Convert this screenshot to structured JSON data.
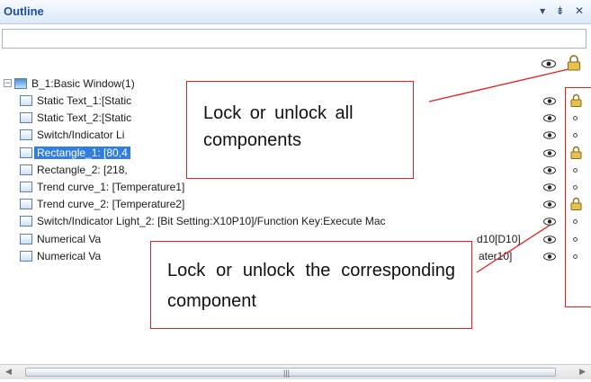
{
  "panel": {
    "title": "Outline",
    "controls": [
      "▾",
      "⇟",
      "✕"
    ],
    "search_value": ""
  },
  "tree": {
    "root_label": "B_1:Basic Window(1)",
    "items": [
      {
        "label": "Static Text_1:[Static",
        "icon": "static-text-icon",
        "state": "lock"
      },
      {
        "label": "Static Text_2:[Static",
        "icon": "static-text-icon",
        "state": "unlock"
      },
      {
        "label": "Switch/Indicator Li",
        "icon": "switch-indicator-icon",
        "state": "unlock"
      },
      {
        "label": "Rectangle_1: [80,4",
        "icon": "rectangle-icon",
        "state": "lock",
        "selected": true
      },
      {
        "label": "Rectangle_2: [218,",
        "icon": "rectangle-icon",
        "state": "unlock"
      },
      {
        "label": "Trend curve_1: [Temperature1]",
        "icon": "trend-curve-icon",
        "state": "unlock"
      },
      {
        "label": "Trend curve_2: [Temperature2]",
        "icon": "trend-curve-icon",
        "state": "lock"
      },
      {
        "label": "Switch/Indicator Light_2: [Bit Setting:X10P10]/Function Key:Execute Mac",
        "icon": "switch-indicator-icon",
        "state": "unlock"
      },
      {
        "label": "Numerical Va",
        "suffix": "d10[D10]",
        "icon": "numerical-value-icon",
        "state": "unlock"
      },
      {
        "label": "Numerical Va",
        "suffix": "ater10]",
        "icon": "numerical-value-icon",
        "state": "unlock"
      }
    ]
  },
  "callouts": {
    "top": "Lock or unlock all components",
    "bottom": "Lock or unlock the corresponding component"
  },
  "colors": {
    "callout_border": "#e0201e",
    "selection": "#2f7ee0",
    "title_text": "#1e4fa0"
  }
}
